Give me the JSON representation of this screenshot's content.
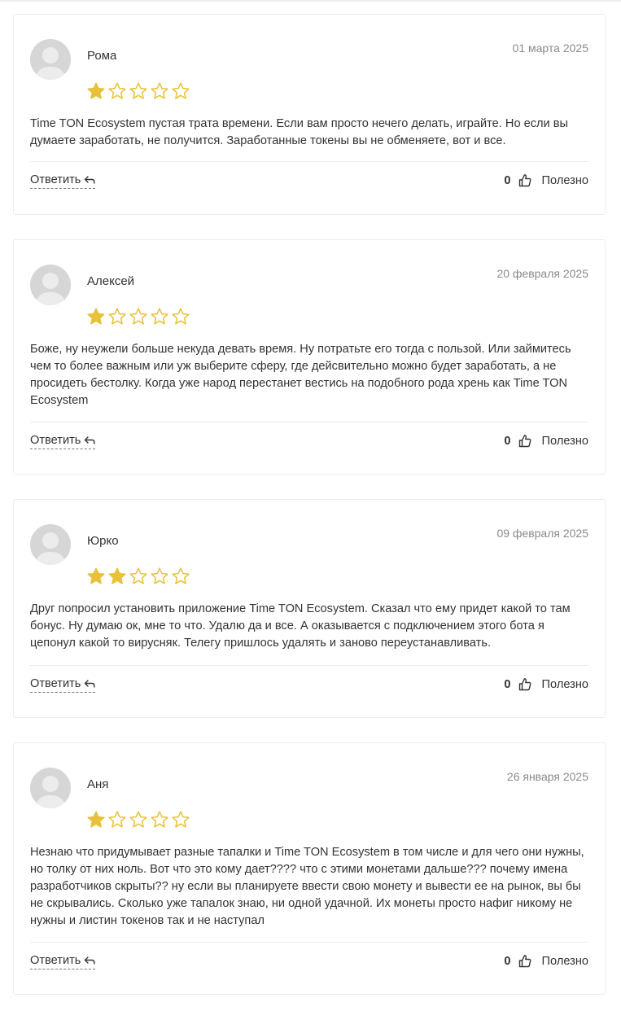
{
  "reviews": [
    {
      "author": "Рома",
      "date": "01 марта 2025",
      "rating": 1,
      "text": "Time TON Ecosystem пустая трата времени. Если вам просто нечего делать, играйте. Но если вы думаете заработать, не получится. Заработанные токены вы не обменяете, вот и все.",
      "reply_label": "Ответить",
      "likes": "0",
      "useful_label": "Полезно"
    },
    {
      "author": "Алексей",
      "date": "20 февраля 2025",
      "rating": 1,
      "text": "Боже, ну неужели больше некуда девать время. Ну потратьте его тогда с пользой. Или займитесь чем то более важным или уж выберите сферу, где дейсвительно можно будет заработать, а не просидеть бестолку. Когда уже народ перестанет вестись на подобного рода хрень как Time TON Ecosystem",
      "reply_label": "Ответить",
      "likes": "0",
      "useful_label": "Полезно"
    },
    {
      "author": "Юрко",
      "date": "09 февраля 2025",
      "rating": 2,
      "text": "Друг попросил установить приложение Time TON Ecosystem. Сказал что ему придет какой то там бонус. Ну думаю ок, мне то что. Удалю да и все. А оказывается с подключением этого бота я цепонул какой то вирусняк. Телегу пришлось удалять и заново переустанавливать.",
      "reply_label": "Ответить",
      "likes": "0",
      "useful_label": "Полезно"
    },
    {
      "author": "Аня",
      "date": "26 января 2025",
      "rating": 1,
      "text": "Незнаю что придумывает разные тапалки и Time TON Ecosystem в том числе и для чего они нужны, но толку от них ноль. Вот что это кому дает???? что с этими монетами дальше??? почему имена разработчиков скрыты?? ну если вы планируете ввести свою монету и вывести ее на рынок, вы бы не скрывались. Сколько уже тапалок знаю, ни одной удачной. Их монеты просто нафиг никому не нужны и листин токенов так и не наступал",
      "reply_label": "Ответить",
      "likes": "0",
      "useful_label": "Полезно"
    }
  ],
  "max_rating": 5,
  "colors": {
    "star": "#e8c13a",
    "avatar_bg": "#d6d6d6",
    "date": "#8a8a8a",
    "border": "#ececec"
  },
  "icons": {
    "avatar": "user-silhouette-icon",
    "star": "star-icon",
    "reply": "reply-arrow-icon",
    "like": "thumbs-up-icon"
  }
}
